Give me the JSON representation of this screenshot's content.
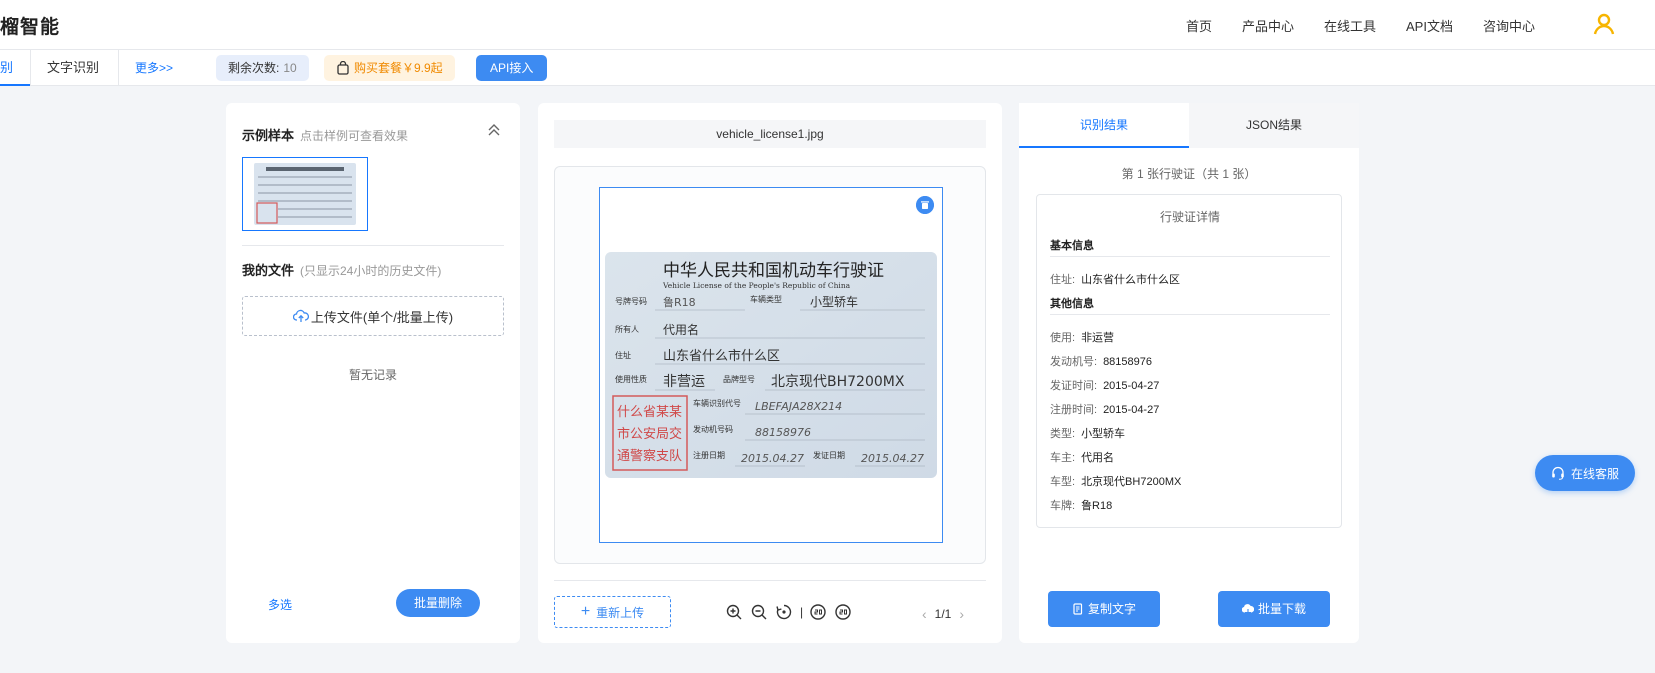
{
  "header": {
    "brand": "榴智能",
    "nav": [
      "首页",
      "产品中心",
      "在线工具",
      "API文档",
      "咨询中心"
    ]
  },
  "subbar": {
    "active_tab": "别",
    "tab_text_ocr": "文字识别",
    "more": "更多>>",
    "remaining_label": "剩余次数:",
    "remaining_count": "10",
    "buy": "购买套餐￥9.9起",
    "api": "API接入"
  },
  "left": {
    "samples_title": "示例样本",
    "samples_hint": "点击样例可查看效果",
    "myfiles_title": "我的文件",
    "myfiles_hint": "(只显示24小时的历史文件)",
    "upload": "上传文件(单个/批量上传)",
    "empty": "暂无记录",
    "multi": "多选",
    "delete": "批量删除"
  },
  "center": {
    "filename": "vehicle_license1.jpg",
    "reupload": "重新上传",
    "page": "1/1",
    "license": {
      "title_cn": "中华人民共和国机动车行驶证",
      "title_en": "Vehicle License of the People's Republic of China",
      "plate_label": "号牌号码",
      "plate": "鲁R18",
      "type_label": "车辆类型",
      "type": "小型轿车",
      "owner_label": "所有人",
      "owner": "代用名",
      "addr_label": "住址",
      "addr": "山东省什么市什么区",
      "use_label": "使用性质",
      "use": "非营运",
      "model_label": "品牌型号",
      "model": "北京现代BH7200MX",
      "vin_label": "车辆识别代号",
      "vin": "LBEFAJA28X214",
      "engine_label": "发动机号码",
      "engine": "88158976",
      "reg_label": "注册日期",
      "reg": "2015.04.27",
      "issue_label": "发证日期",
      "issue": "2015.04.27",
      "stamp": [
        "什么省某某",
        "市公安局交",
        "通警察支队"
      ]
    }
  },
  "right": {
    "tab_result": "识别结果",
    "tab_json": "JSON结果",
    "summary": "第 1 张行驶证（共 1 张）",
    "card_title": "行驶证详情",
    "group_basic": "基本信息",
    "basic": [
      {
        "k": "住址:",
        "v": "山东省什么市什么区"
      }
    ],
    "group_other": "其他信息",
    "other": [
      {
        "k": "使用:",
        "v": "非运营"
      },
      {
        "k": "发动机号:",
        "v": "88158976"
      },
      {
        "k": "发证时间:",
        "v": "2015-04-27"
      },
      {
        "k": "注册时间:",
        "v": "2015-04-27"
      },
      {
        "k": "类型:",
        "v": "小型轿车"
      },
      {
        "k": "车主:",
        "v": "代用名"
      },
      {
        "k": "车型:",
        "v": "北京现代BH7200MX"
      },
      {
        "k": "车牌:",
        "v": "鲁R18"
      }
    ],
    "copy": "复制文字",
    "download": "批量下载"
  },
  "service": "在线客服",
  "colors": {
    "accent": "#3d8bf2",
    "link": "#1677ff",
    "buy": "#f08a00"
  }
}
